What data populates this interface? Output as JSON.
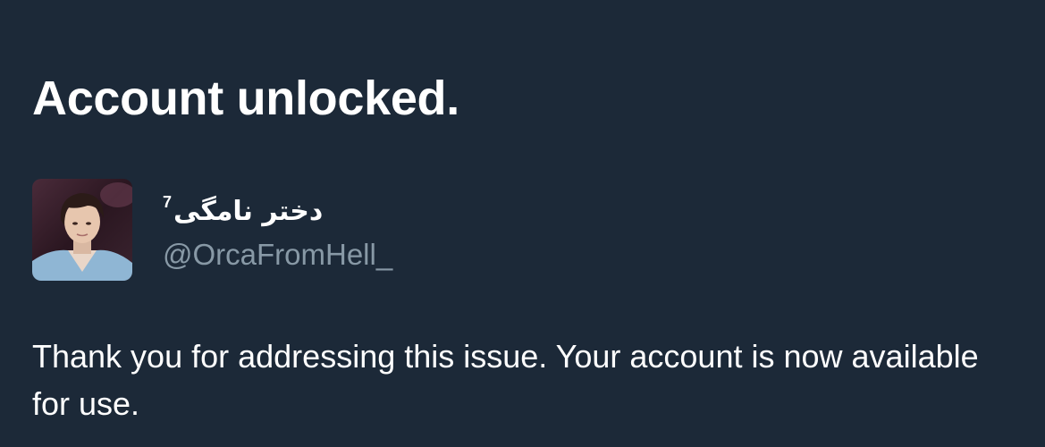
{
  "header": {
    "title": "Account unlocked."
  },
  "account": {
    "display_name": "دختر نامگی",
    "display_name_superscript": "7",
    "handle": "@OrcaFromHell_",
    "avatar_icon": "profile-photo"
  },
  "body": {
    "message": "Thank you for addressing this issue. Your account is now available for use."
  },
  "colors": {
    "background": "#1c2938",
    "primary_text": "#ffffff",
    "secondary_text": "#8899a6"
  }
}
